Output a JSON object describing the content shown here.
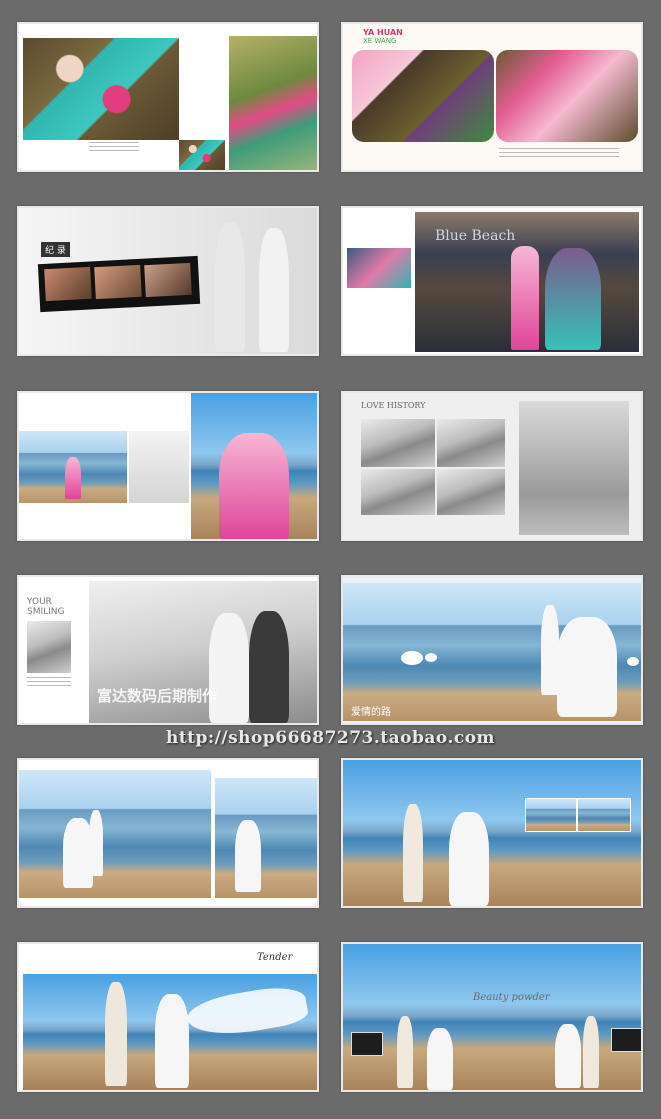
{
  "watermark": {
    "url": "http://shop66687273.taobao.com"
  },
  "tiles": {
    "t2": {
      "brand_line1": "YA HUAN",
      "brand_line2": "XE WANG"
    },
    "t3": {
      "title": "纪 录"
    },
    "t4": {
      "sign": "Blue Beach"
    },
    "t6": {
      "title": "LOVE HISTORY"
    },
    "t7": {
      "title_line1": "YOUR",
      "title_line2": "SMILING",
      "overlay": "富达数码后期制作"
    },
    "t8": {
      "caption": "爱情的路"
    },
    "t11": {
      "title": "Tender"
    },
    "t12": {
      "title": "Beauty powder"
    }
  }
}
